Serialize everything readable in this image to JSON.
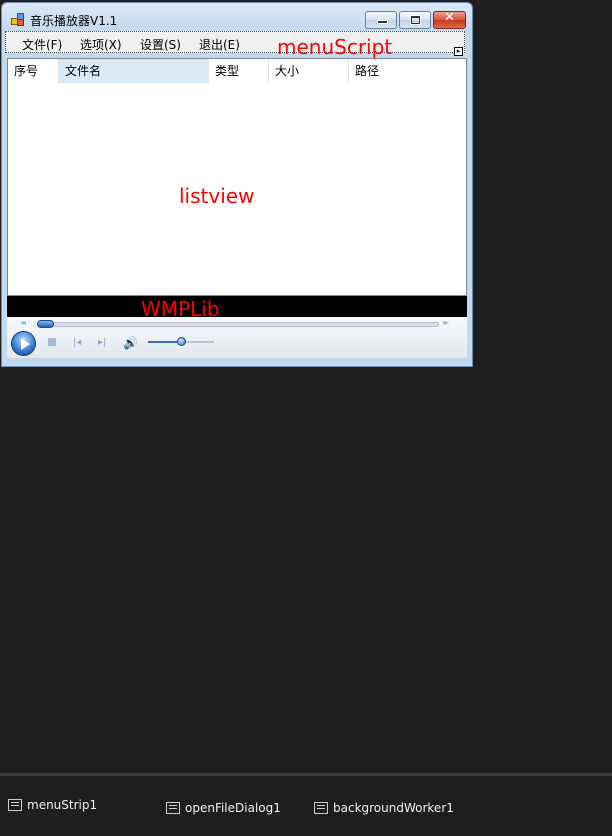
{
  "window": {
    "title": "音乐播放器V1.1",
    "close_glyph": "✕"
  },
  "menu": {
    "items": [
      {
        "label": "文件(F)"
      },
      {
        "label": "选项(X)"
      },
      {
        "label": "设置(S)"
      },
      {
        "label": "退出(E)"
      }
    ],
    "smart_tag_glyph": "▸"
  },
  "annotations": {
    "menu": "menuScript",
    "list": "listview",
    "player": "WMPLib"
  },
  "listview": {
    "columns": [
      {
        "label": "序号"
      },
      {
        "label": "文件名"
      },
      {
        "label": "类型"
      },
      {
        "label": "大小"
      },
      {
        "label": "路径"
      }
    ],
    "rows": []
  },
  "player": {
    "rewind_glyph": "◂◂",
    "forward_glyph": "▸▸",
    "prev_glyph": "|◂",
    "next_glyph": "▸|",
    "volume_glyph": "🔊",
    "seek_position": 0.0,
    "volume_level": 0.5
  },
  "tray": {
    "components": [
      {
        "label": "menuStrip1",
        "icon": "menustrip-icon"
      },
      {
        "label": "openFileDialog1",
        "icon": "dialog-icon"
      },
      {
        "label": "backgroundWorker1",
        "icon": "worker-icon"
      }
    ]
  },
  "colors": {
    "annotation": "#ff0000",
    "selected_header": "#dbe8f6",
    "designer_background": "#1e1e1e"
  }
}
